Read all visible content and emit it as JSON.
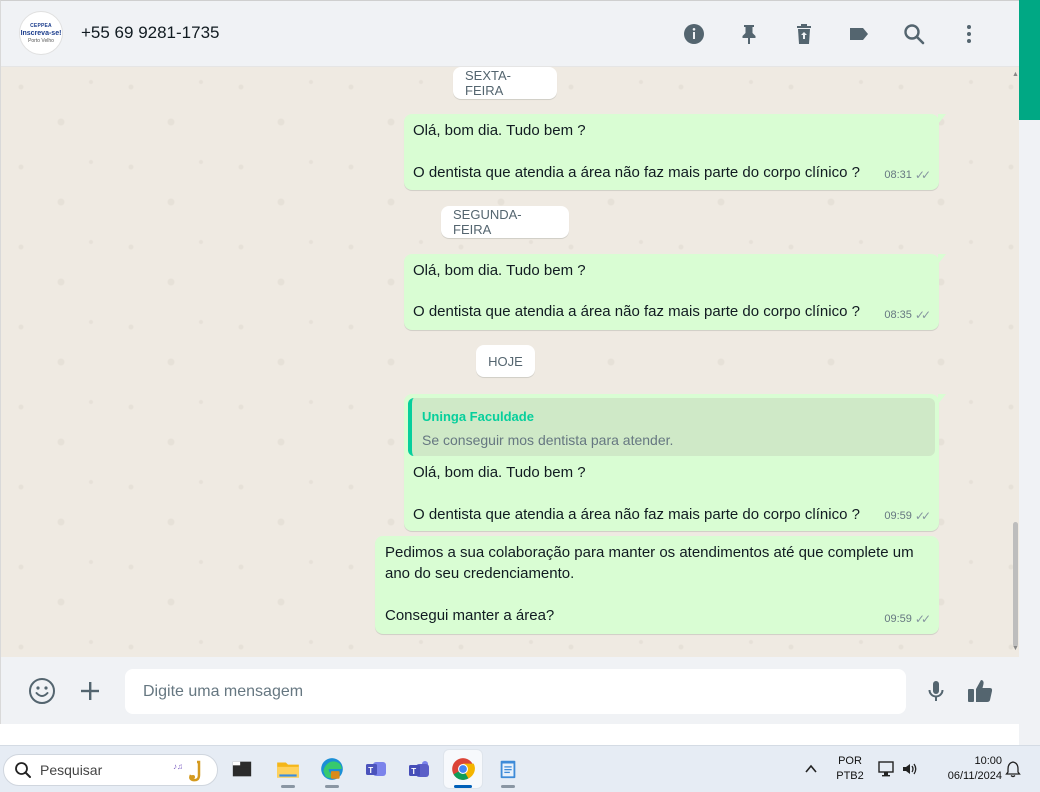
{
  "header": {
    "contact_name": "+55 69 9281-1735",
    "avatar": {
      "line1": "CEPPEA",
      "line2": "Inscreva-se!",
      "line3": "Porto Velho"
    },
    "icons": [
      "info-icon",
      "pin-icon",
      "delete-icon",
      "label-icon",
      "search-icon",
      "menu-icon"
    ]
  },
  "chat": {
    "dates": [
      "SEXTA-FEIRA",
      "SEGUNDA-FEIRA",
      "HOJE"
    ],
    "messages": [
      {
        "line1": "Olá, bom dia. Tudo bem ?",
        "line2": "O dentista que atendia a área não faz mais parte do corpo clínico ?",
        "time": "08:31"
      },
      {
        "line1": "Olá, bom dia. Tudo bem ?",
        "line2": "O dentista que atendia a área não faz mais parte do corpo clínico ?",
        "time": "08:35"
      },
      {
        "quote_author": "Uninga Faculdade",
        "quote_text": "Se conseguir mos dentista para atender.",
        "line1": "Olá, bom dia. Tudo bem ?",
        "line2": "O dentista que atendia a área não faz mais parte do corpo clínico ?",
        "time": "09:59"
      },
      {
        "line1": "Pedimos a sua colaboração para manter os atendimentos até que complete um",
        "line2": "ano do seu credenciamento.",
        "line3": "Consegui manter a área?",
        "time": "09:59"
      }
    ]
  },
  "composer": {
    "placeholder": "Digite uma mensagem"
  },
  "taskbar": {
    "search_label": "Pesquisar",
    "apps": [
      "terminal",
      "file-explorer",
      "edge",
      "teams-classic",
      "teams",
      "chrome",
      "notepad"
    ],
    "lang_line1": "POR",
    "lang_line2": "PTB2",
    "time": "10:00",
    "date": "06/11/2024"
  },
  "colors": {
    "accent": "#00a884",
    "bubble": "#d9fdd3",
    "quote_author": "#06cf9c"
  }
}
